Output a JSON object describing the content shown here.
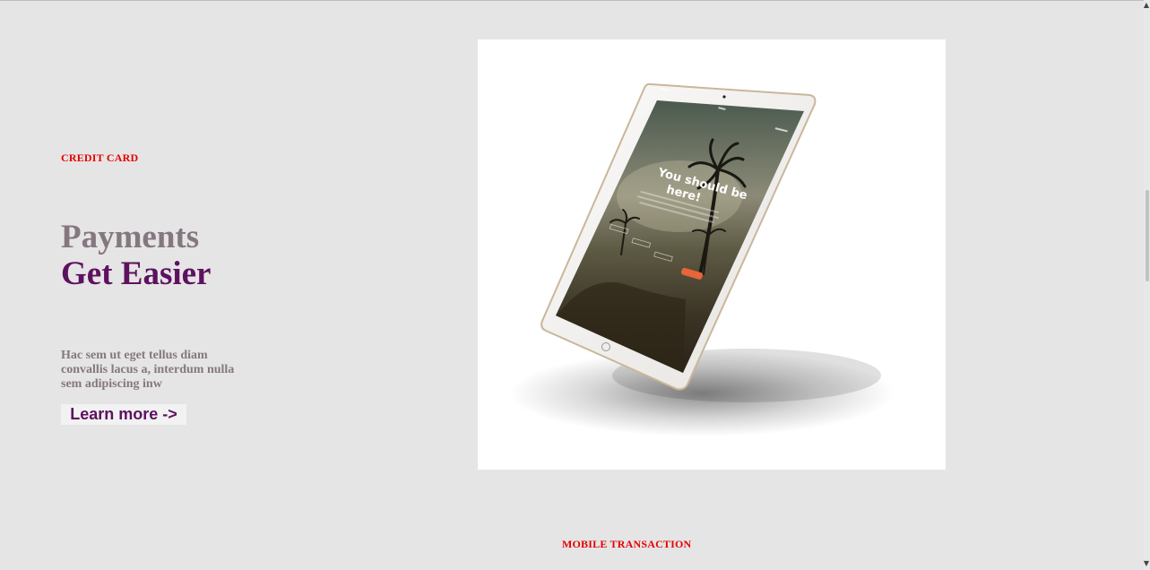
{
  "hero": {
    "eyebrow": "CREDIT CARD",
    "headline_line1": "Payments",
    "headline_line2": "Get Easier",
    "description": "Hac sem ut eget tellus diam convallis lacus a, interdum nulla sem adipiscing inw",
    "cta_label": "Learn more ->"
  },
  "tablet_screen": {
    "heading_line1": "You should be",
    "heading_line2": "here!"
  },
  "next_section": {
    "eyebrow": "MOBILE TRANSACTION"
  },
  "colors": {
    "background": "#e5e5e5",
    "eyebrow": "#e60000",
    "headline_muted": "#85777f",
    "headline_accent": "#5e1160",
    "cta_background": "#f2f2f2",
    "tablet_button": "#e8643a"
  },
  "icons": {
    "scroll_up": "triangle-up-icon",
    "scroll_down": "triangle-down-icon"
  }
}
